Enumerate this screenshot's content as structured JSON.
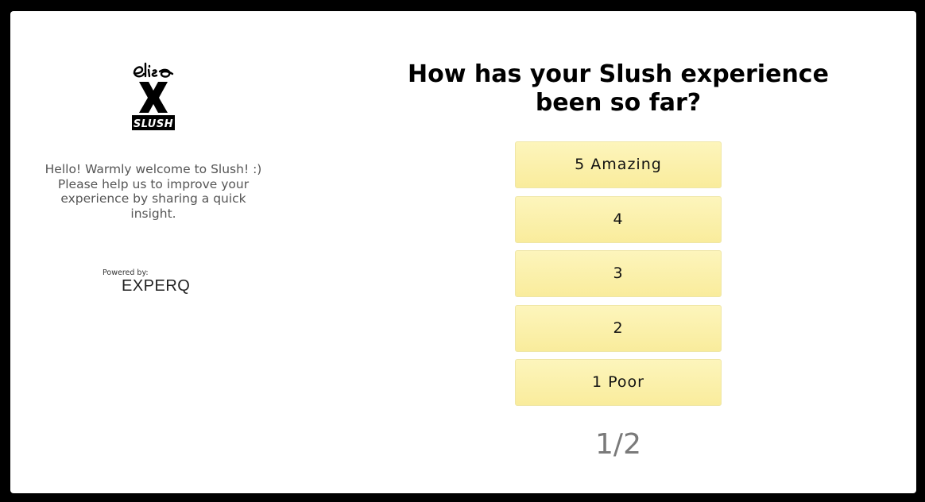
{
  "logo": {
    "top_text": "elisa",
    "middle_text": "X",
    "bottom_text": "SLUSH"
  },
  "welcome": {
    "lines": [
      "Hello! Warmly welcome to Slush! :)",
      "Please help us to improve your",
      "experience by sharing a quick",
      "insight."
    ]
  },
  "powered_by": {
    "label": "Powered by:",
    "brand": "EXPERQ"
  },
  "question": {
    "lines": [
      "How has your Slush experience",
      "been so far?"
    ]
  },
  "options": [
    {
      "label": "5 Amazing"
    },
    {
      "label": "4"
    },
    {
      "label": "3"
    },
    {
      "label": "2"
    },
    {
      "label": "1 Poor"
    }
  ],
  "progress": "1/2",
  "colors": {
    "background": "#000000",
    "card": "#ffffff",
    "option_fill": "#fbf0a8",
    "option_border": "#efe6a6",
    "progress_text": "#7a7a7a"
  }
}
